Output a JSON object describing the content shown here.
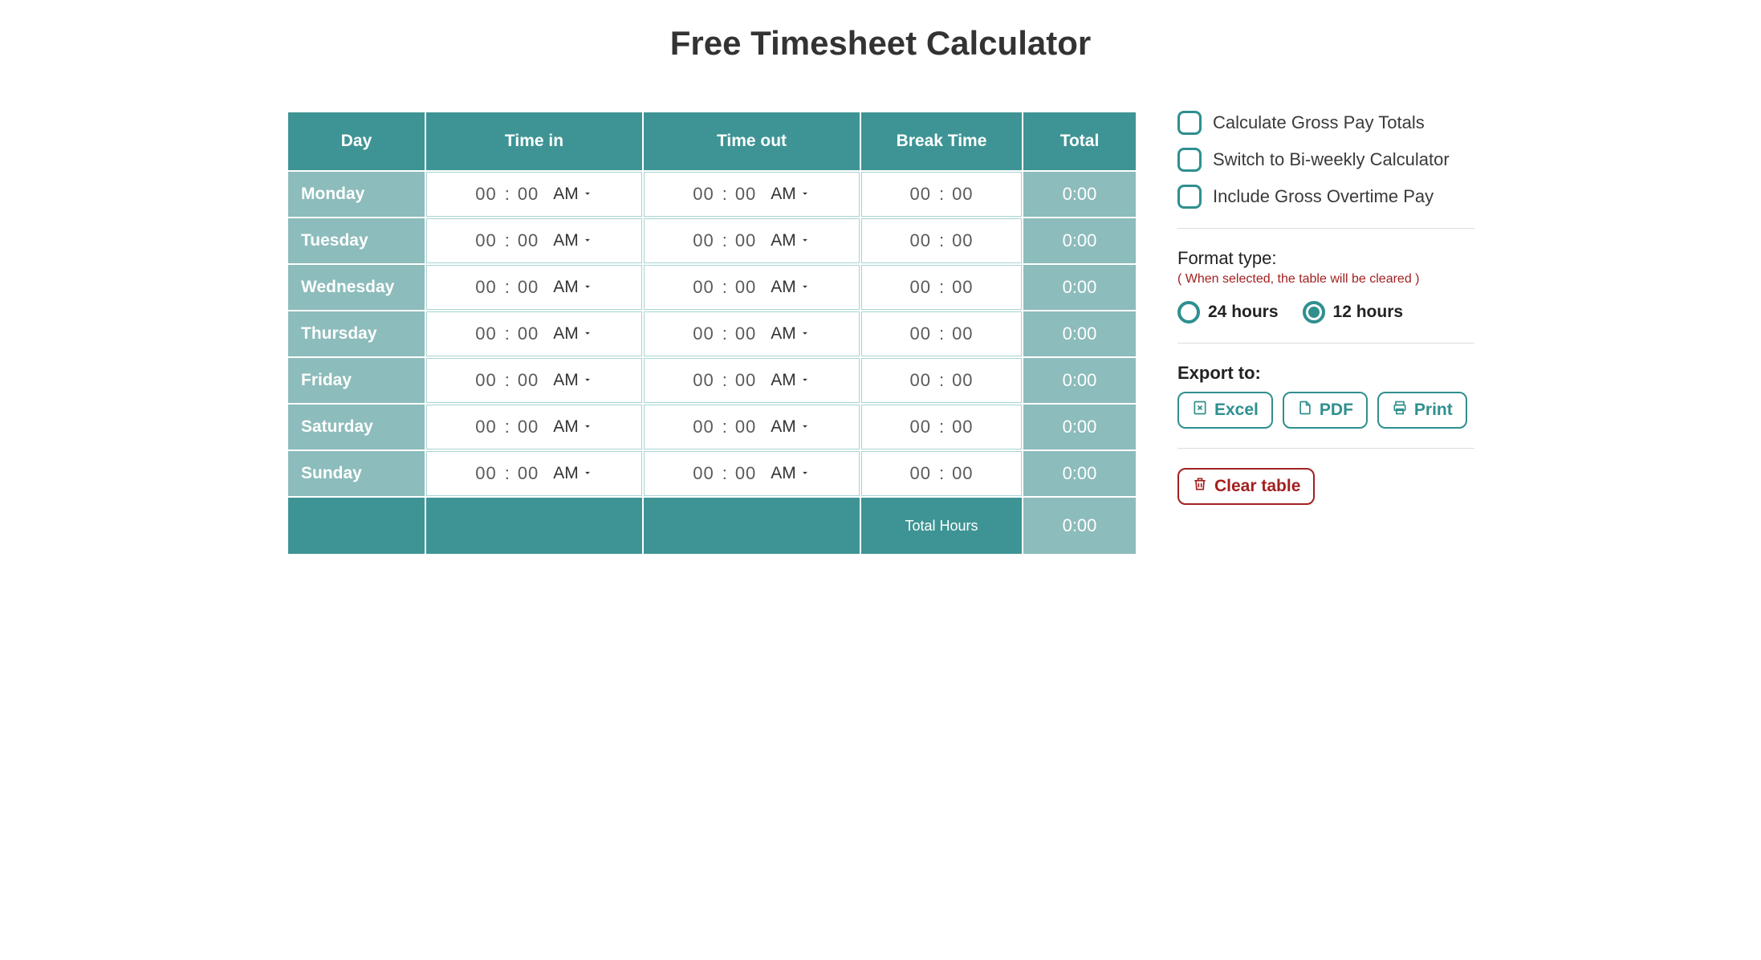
{
  "title": "Free Timesheet Calculator",
  "table": {
    "headers": {
      "day": "Day",
      "time_in": "Time in",
      "time_out": "Time out",
      "break": "Break Time",
      "total": "Total"
    },
    "rows": [
      {
        "day": "Monday",
        "in_h": "00",
        "in_m": "00",
        "in_ap": "AM",
        "out_h": "00",
        "out_m": "00",
        "out_ap": "AM",
        "br_h": "00",
        "br_m": "00",
        "total": "0:00"
      },
      {
        "day": "Tuesday",
        "in_h": "00",
        "in_m": "00",
        "in_ap": "AM",
        "out_h": "00",
        "out_m": "00",
        "out_ap": "AM",
        "br_h": "00",
        "br_m": "00",
        "total": "0:00"
      },
      {
        "day": "Wednesday",
        "in_h": "00",
        "in_m": "00",
        "in_ap": "AM",
        "out_h": "00",
        "out_m": "00",
        "out_ap": "AM",
        "br_h": "00",
        "br_m": "00",
        "total": "0:00"
      },
      {
        "day": "Thursday",
        "in_h": "00",
        "in_m": "00",
        "in_ap": "AM",
        "out_h": "00",
        "out_m": "00",
        "out_ap": "AM",
        "br_h": "00",
        "br_m": "00",
        "total": "0:00"
      },
      {
        "day": "Friday",
        "in_h": "00",
        "in_m": "00",
        "in_ap": "AM",
        "out_h": "00",
        "out_m": "00",
        "out_ap": "AM",
        "br_h": "00",
        "br_m": "00",
        "total": "0:00"
      },
      {
        "day": "Saturday",
        "in_h": "00",
        "in_m": "00",
        "in_ap": "AM",
        "out_h": "00",
        "out_m": "00",
        "out_ap": "AM",
        "br_h": "00",
        "br_m": "00",
        "total": "0:00"
      },
      {
        "day": "Sunday",
        "in_h": "00",
        "in_m": "00",
        "in_ap": "AM",
        "out_h": "00",
        "out_m": "00",
        "out_ap": "AM",
        "br_h": "00",
        "br_m": "00",
        "total": "0:00"
      }
    ],
    "footer": {
      "label": "Total Hours",
      "value": "0:00"
    }
  },
  "sidebar": {
    "options": [
      {
        "label": "Calculate Gross Pay Totals",
        "checked": false
      },
      {
        "label": "Switch to Bi-weekly Calculator",
        "checked": false
      },
      {
        "label": "Include Gross Overtime Pay",
        "checked": false
      }
    ],
    "format": {
      "title": "Format type:",
      "warn": "( When selected, the table will be cleared )",
      "opts": [
        {
          "label": "24 hours",
          "selected": false
        },
        {
          "label": "12 hours",
          "selected": true
        }
      ]
    },
    "export": {
      "title": "Export to:",
      "buttons": {
        "excel": "Excel",
        "pdf": "PDF",
        "print": "Print"
      }
    },
    "clear": "Clear table"
  }
}
